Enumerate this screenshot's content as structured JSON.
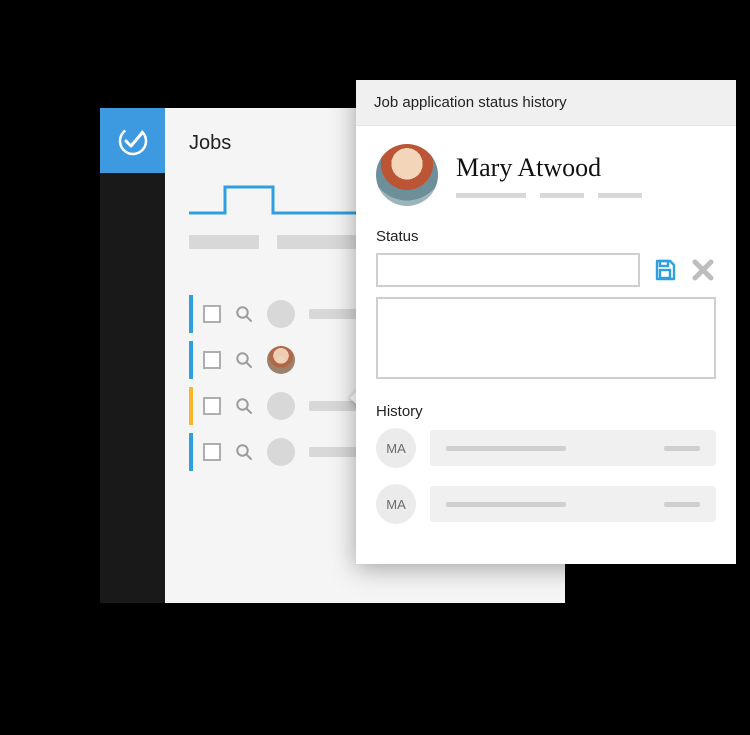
{
  "jobs": {
    "title": "Jobs",
    "rows": [
      {
        "accent": "blue",
        "has_photo": false
      },
      {
        "accent": "blue",
        "has_photo": true
      },
      {
        "accent": "yellow",
        "has_photo": false
      },
      {
        "accent": "blue",
        "has_photo": false
      }
    ]
  },
  "popover": {
    "title": "Job application status history",
    "person_name": "Mary Atwood",
    "status_label": "Status",
    "status_value": "",
    "history_label": "History",
    "history": [
      {
        "initials": "MA"
      },
      {
        "initials": "MA"
      }
    ]
  },
  "colors": {
    "brand": "#3d99e0",
    "accent_yellow": "#f8b42a"
  }
}
